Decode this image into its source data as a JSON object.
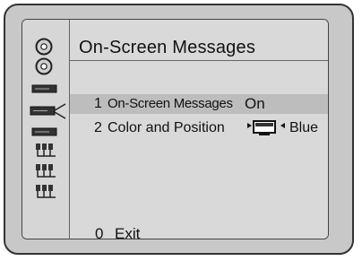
{
  "menu": {
    "title": "On-Screen Messages",
    "items": [
      {
        "number": "1",
        "label": "On-Screen Messages",
        "value": "On",
        "selected": true
      },
      {
        "number": "2",
        "label": "Color and Position",
        "value": "Blue",
        "selected": false
      }
    ],
    "exit": {
      "number": "0",
      "label": "Exit"
    }
  },
  "sidebar": {
    "icons": [
      "disc-icon",
      "disc-icon",
      "vcr-icon",
      "vcr-icon-selected",
      "vcr-icon",
      "connector-icon",
      "connector-icon",
      "connector-icon"
    ]
  },
  "colors": {
    "panel": "#d9d9d9",
    "selected_row": "#bdbdbd",
    "frame": "#c8c8c8"
  }
}
